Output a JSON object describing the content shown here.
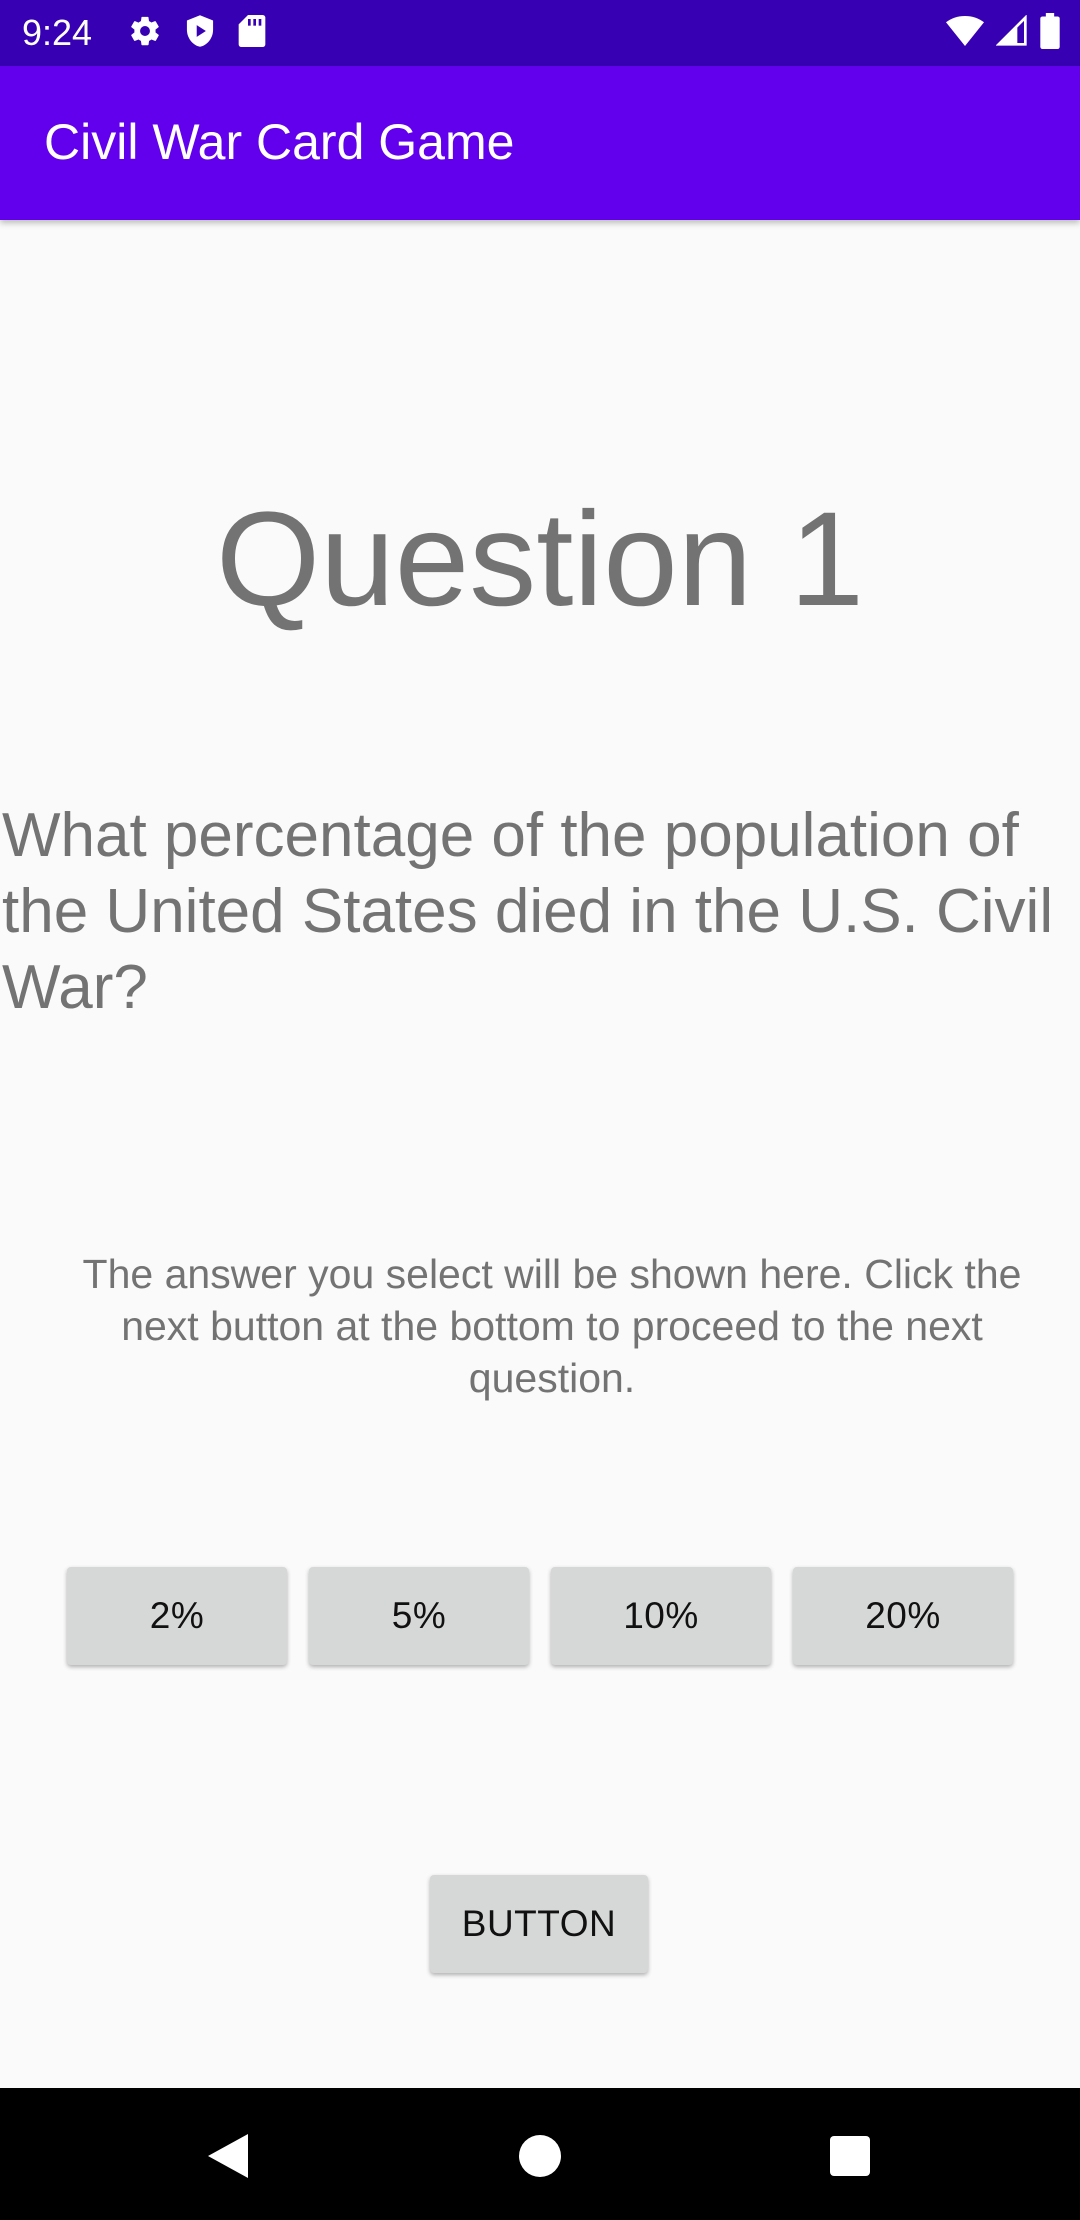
{
  "status_bar": {
    "time": "9:24",
    "left_icons": [
      "gear-icon",
      "shield-play-icon",
      "sd-card-icon"
    ],
    "right_icons": [
      "wifi-icon",
      "cell-signal-icon",
      "battery-icon"
    ],
    "background": "#3700b3"
  },
  "app_bar": {
    "title": "Civil War Card Game",
    "background": "#6200ee"
  },
  "question": {
    "heading": "Question 1",
    "text": "What percentage of the population of the United States died in the U.S. Civil War?"
  },
  "answer_display": {
    "text": "The answer you select will be shown here. Click the next button at the bottom to proceed to the next question."
  },
  "options": [
    "2%",
    "5%",
    "10%",
    "20%"
  ],
  "next_button": {
    "label": "BUTTON"
  },
  "nav_bar": {
    "icons": [
      "back-icon",
      "home-icon",
      "recents-icon"
    ]
  }
}
